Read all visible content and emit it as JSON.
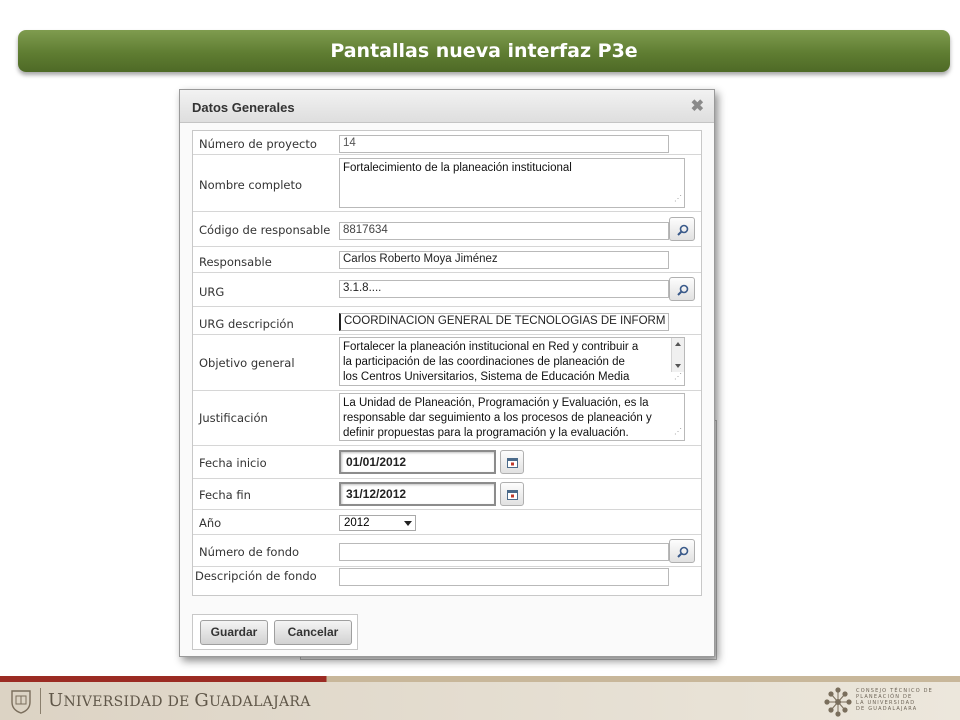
{
  "slide": {
    "title": "Pantallas nueva interfaz P3e"
  },
  "dialog": {
    "title": "Datos Generales",
    "close_symbol": "✖",
    "fields": {
      "numero_proyecto": {
        "label": "Número de proyecto",
        "value": "14"
      },
      "nombre_completo": {
        "label": "Nombre completo",
        "value": "Fortalecimiento de la planeación institucional"
      },
      "codigo_responsable": {
        "label": "Código de responsable",
        "value": "8817634"
      },
      "responsable": {
        "label": "Responsable",
        "value": "Carlos Roberto Moya Jiménez"
      },
      "urg": {
        "label": "URG",
        "value": "3.1.8...."
      },
      "urg_descripcion": {
        "label": "URG descripción",
        "value": "COORDINACION GENERAL DE TECNOLOGIAS DE INFORM"
      },
      "objetivo_general": {
        "label": "Objetivo general",
        "lines": [
          "Fortalecer la planeación institucional en Red y contribuir a",
          "la participación de las coordinaciones de planeación de",
          "los Centros Universitarios, Sistema de Educación Media"
        ]
      },
      "justificacion": {
        "label": "Justificación",
        "lines": [
          "La Unidad de Planeación, Programación y Evaluación, es la",
          "responsable dar seguimiento a los procesos de planeación y",
          "definir propuestas para la programación y la evaluación."
        ]
      },
      "fecha_inicio": {
        "label": "Fecha inicio",
        "value": "01/01/2012"
      },
      "fecha_fin": {
        "label": "Fecha fin",
        "value": "31/12/2012"
      },
      "anio": {
        "label": "Año",
        "value": "2012"
      },
      "numero_fondo": {
        "label": "Número de fondo",
        "value": ""
      },
      "descripcion_fondo": {
        "label": "Descripción de fondo",
        "value": ""
      }
    },
    "buttons": {
      "save": "Guardar",
      "cancel": "Cancelar"
    }
  },
  "footer": {
    "university_first": "U",
    "university_rest1": "NIVERSIDAD DE ",
    "university_g": "G",
    "university_rest2": "UADALAJARA",
    "council_lines": [
      "Consejo Técnico de",
      "Planeación de",
      "la Universidad",
      "de Guadalajara"
    ]
  },
  "colors": {
    "banner": "#5f7d32",
    "accent_red": "#9b2b23"
  },
  "icons": [
    "search-icon",
    "calendar-icon",
    "close-icon",
    "dropdown-caret-icon",
    "resize-grip-icon",
    "university-seal-icon",
    "council-logo-icon"
  ]
}
